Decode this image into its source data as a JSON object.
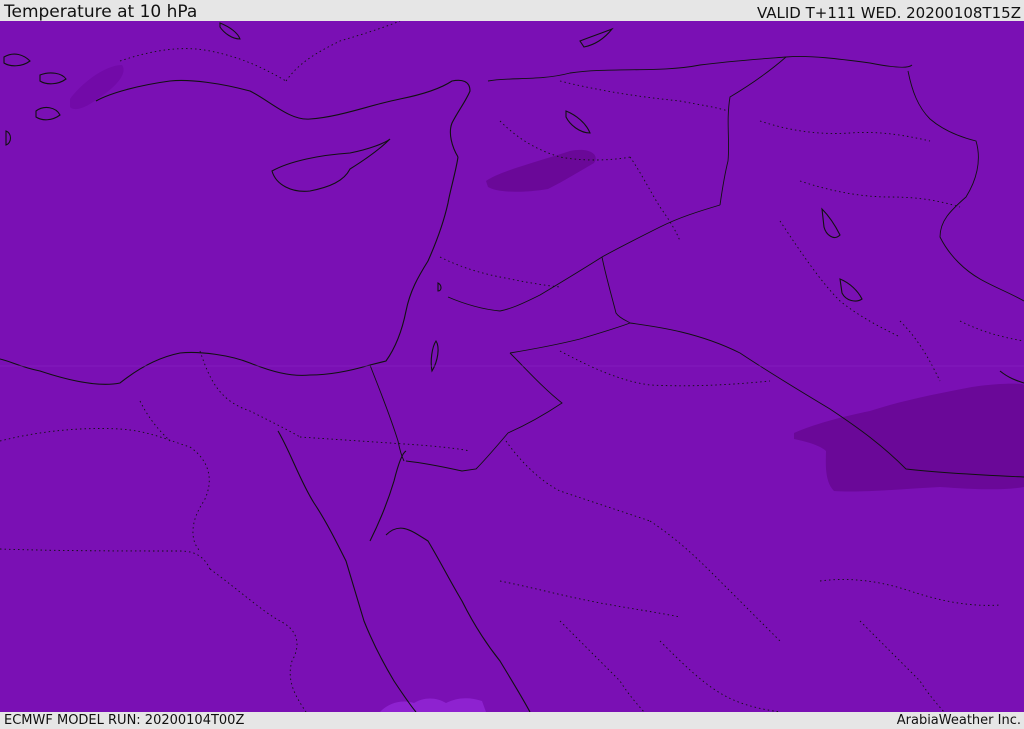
{
  "header": {
    "title": "Temperature at 10 hPa",
    "valid": "VALID T+111 WED. 20200108T15Z"
  },
  "footer": {
    "model_run": "ECMWF MODEL RUN: 20200104T00Z",
    "credit": "ArabiaWeather Inc."
  },
  "map": {
    "fill_color": "#7a10b4",
    "cold_patch_color": "#6a0898",
    "light_patch_color": "#8e22d0",
    "line_color": "#111111"
  }
}
